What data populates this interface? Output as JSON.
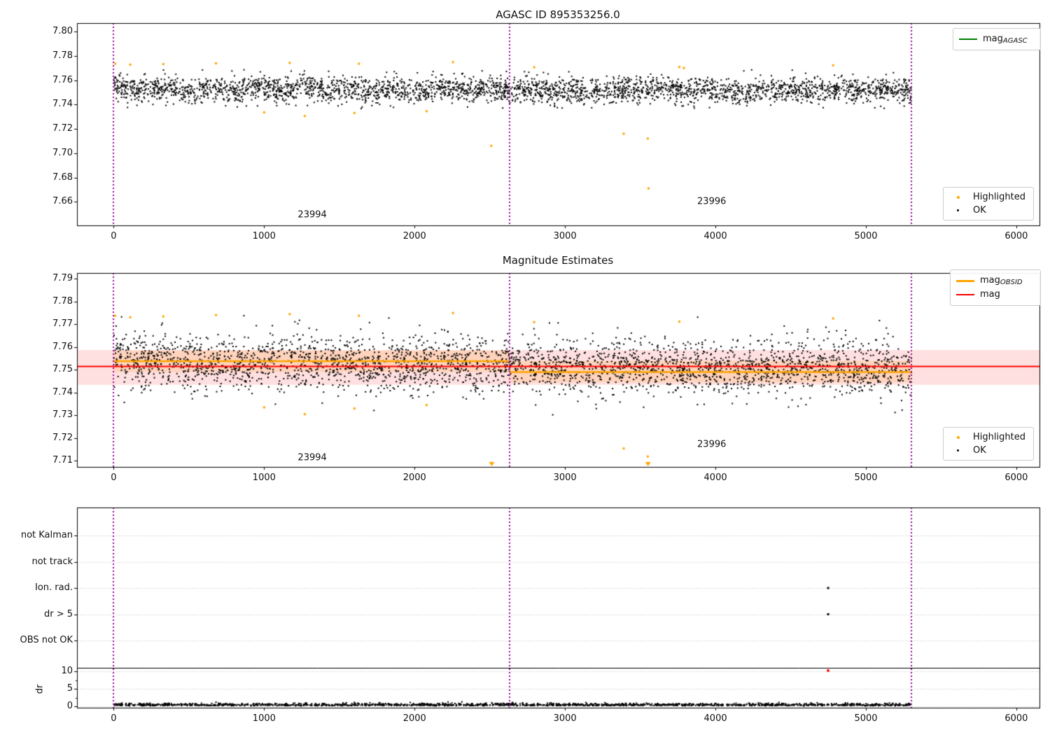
{
  "figure": {
    "background": "#ffffff"
  },
  "colors": {
    "ok": "#000000",
    "highlighted": "#FFA500",
    "mag_line": "#ff0000",
    "mag_band": "rgba(255,0,0,0.12)",
    "obsid_line": "#FFA500",
    "obsid_band": "rgba(255,165,0,0.16)",
    "agasc_line": "#008000",
    "vline": "#9b009b",
    "grid": "#c9c9c9"
  },
  "chart_data": [
    {
      "type": "scatter",
      "title": "AGASC ID 895353256.0",
      "xlim": [
        -244,
        6154
      ],
      "ylim": [
        7.6406,
        7.8069
      ],
      "grid": false,
      "xticks": [
        {
          "v": 0,
          "t": "0"
        },
        {
          "v": 1000,
          "t": "1000"
        },
        {
          "v": 2000,
          "t": "2000"
        },
        {
          "v": 3000,
          "t": "3000"
        },
        {
          "v": 4000,
          "t": "4000"
        },
        {
          "v": 5000,
          "t": "5000"
        },
        {
          "v": 6000,
          "t": "6000"
        }
      ],
      "yticks": [
        {
          "v": 7.8,
          "t": "7.80"
        },
        {
          "v": 7.78,
          "t": "7.78"
        },
        {
          "v": 7.76,
          "t": "7.76"
        },
        {
          "v": 7.74,
          "t": "7.74"
        },
        {
          "v": 7.72,
          "t": "7.72"
        },
        {
          "v": 7.7,
          "t": "7.70"
        },
        {
          "v": 7.68,
          "t": "7.68"
        },
        {
          "v": 7.66,
          "t": "7.66"
        }
      ],
      "vlines": [
        0,
        2632,
        5302
      ],
      "ok_cloud": {
        "n": 3200,
        "x_range": [
          0,
          5302
        ],
        "y_mean": 7.7525,
        "y_std": 0.0052,
        "y_clip": [
          7.7365,
          7.7705
        ],
        "trend": -0.001
      },
      "highlighted_points": [
        [
          10,
          7.7735
        ],
        [
          110,
          7.7728
        ],
        [
          330,
          7.7732
        ],
        [
          680,
          7.7738
        ],
        [
          1170,
          7.7742
        ],
        [
          1630,
          7.7735
        ],
        [
          2255,
          7.7748
        ],
        [
          2795,
          7.7706
        ],
        [
          3760,
          7.7708
        ],
        [
          3790,
          7.77
        ],
        [
          4782,
          7.7722
        ],
        [
          1000,
          7.7335
        ],
        [
          1270,
          7.7305
        ],
        [
          1600,
          7.733
        ],
        [
          2080,
          7.7345
        ],
        [
          2510,
          7.706
        ],
        [
          3390,
          7.716
        ],
        [
          3550,
          7.712
        ],
        [
          3555,
          7.671
        ]
      ],
      "legend_line": {
        "label": "mag",
        "sub": "AGASC",
        "color": "#008000"
      },
      "legend_markers": [
        {
          "label": "Highlighted",
          "color": "#FFA500"
        },
        {
          "label": "OK",
          "color": "#000000"
        }
      ],
      "annotations": [
        {
          "text": "23994",
          "x": 1320,
          "y": 7.649
        },
        {
          "text": "23996",
          "x": 3975,
          "y": 7.66
        }
      ]
    },
    {
      "type": "scatter",
      "title": "Magnitude Estimates",
      "xlim": [
        -244,
        6154
      ],
      "ylim": [
        7.7073,
        7.7926
      ],
      "grid": false,
      "xticks": [
        {
          "v": 0,
          "t": "0"
        },
        {
          "v": 1000,
          "t": "1000"
        },
        {
          "v": 2000,
          "t": "2000"
        },
        {
          "v": 3000,
          "t": "3000"
        },
        {
          "v": 4000,
          "t": "4000"
        },
        {
          "v": 5000,
          "t": "5000"
        },
        {
          "v": 6000,
          "t": "6000"
        }
      ],
      "yticks": [
        {
          "v": 7.79,
          "t": "7.79"
        },
        {
          "v": 7.78,
          "t": "7.78"
        },
        {
          "v": 7.77,
          "t": "7.77"
        },
        {
          "v": 7.76,
          "t": "7.76"
        },
        {
          "v": 7.75,
          "t": "7.75"
        },
        {
          "v": 7.74,
          "t": "7.74"
        },
        {
          "v": 7.73,
          "t": "7.73"
        },
        {
          "v": 7.72,
          "t": "7.72"
        },
        {
          "v": 7.71,
          "t": "7.71"
        }
      ],
      "vlines": [
        0,
        2632,
        5302
      ],
      "ok_cloud": {
        "n": 3200,
        "x_range": [
          0,
          5302
        ],
        "y_mean": 7.754,
        "y_std": 0.0062,
        "y_clip": [
          7.7295,
          7.774
        ],
        "trend": -0.004
      },
      "highlighted_points": [
        [
          10,
          7.7738
        ],
        [
          110,
          7.7731
        ],
        [
          330,
          7.7735
        ],
        [
          680,
          7.7741
        ],
        [
          1170,
          7.7745
        ],
        [
          1630,
          7.7738
        ],
        [
          2255,
          7.775
        ],
        [
          2795,
          7.771
        ],
        [
          3760,
          7.7712
        ],
        [
          4782,
          7.7726
        ],
        [
          1000,
          7.7335
        ],
        [
          1270,
          7.7305
        ],
        [
          1600,
          7.733
        ],
        [
          2080,
          7.7345
        ],
        [
          3390,
          7.7154
        ],
        [
          3550,
          7.7119
        ]
      ],
      "clipped_low_x": [
        2513,
        3552
      ],
      "mag_line": {
        "y": 7.7515,
        "color": "#ff0000"
      },
      "mag_band": {
        "y1": 7.7434,
        "y2": 7.7587
      },
      "obsid_segments": [
        {
          "x1": 0,
          "x2": 2632,
          "y": 7.7538
        },
        {
          "x1": 2632,
          "x2": 5302,
          "y": 7.749
        }
      ],
      "obsid_bands": [
        {
          "x1": 0,
          "x2": 2632,
          "y1": 7.749,
          "y2": 7.7585
        },
        {
          "x1": 2632,
          "x2": 5302,
          "y1": 7.7445,
          "y2": 7.754
        }
      ],
      "legend_lines": [
        {
          "label": "mag",
          "sub": "OBSID",
          "color": "#FFA500"
        },
        {
          "label": "mag",
          "sub": "",
          "color": "#ff0000"
        }
      ],
      "legend_markers": [
        {
          "label": "Highlighted",
          "color": "#FFA500"
        },
        {
          "label": "OK",
          "color": "#000000"
        }
      ],
      "annotations": [
        {
          "text": "23994",
          "x": 1320,
          "y": 7.7114
        },
        {
          "text": "23996",
          "x": 3975,
          "y": 7.7173
        }
      ]
    },
    {
      "type": "scatter",
      "title": "",
      "xlim": [
        -244,
        6154
      ],
      "grid": true,
      "xticks": [
        {
          "v": 0,
          "t": "0"
        },
        {
          "v": 1000,
          "t": "1000"
        },
        {
          "v": 2000,
          "t": "2000"
        },
        {
          "v": 3000,
          "t": "3000"
        },
        {
          "v": 4000,
          "t": "4000"
        },
        {
          "v": 5000,
          "t": "5000"
        },
        {
          "v": 6000,
          "t": "6000"
        }
      ],
      "categories": [
        "not Kalman",
        "not track",
        "Ion. rad.",
        "dr > 5",
        "OBS not OK"
      ],
      "dr_ticks": [
        {
          "v": 10,
          "t": "10"
        },
        {
          "v": 5,
          "t": "5"
        },
        {
          "v": 0,
          "t": "0"
        }
      ],
      "ylabel": "dr",
      "vlines": [
        0,
        2632,
        5302
      ],
      "dr_cloud": {
        "n": 1700,
        "x_range": [
          0,
          5302
        ],
        "dr_low": 0.1,
        "dr_high": 0.9
      },
      "flag_points": [
        {
          "x": 4749,
          "category": "Ion. rad."
        },
        {
          "x": 4749,
          "category": "dr > 5"
        }
      ],
      "dr_outlier": {
        "x": 4749,
        "dr": 10.2,
        "color": "#ff0000"
      }
    }
  ]
}
